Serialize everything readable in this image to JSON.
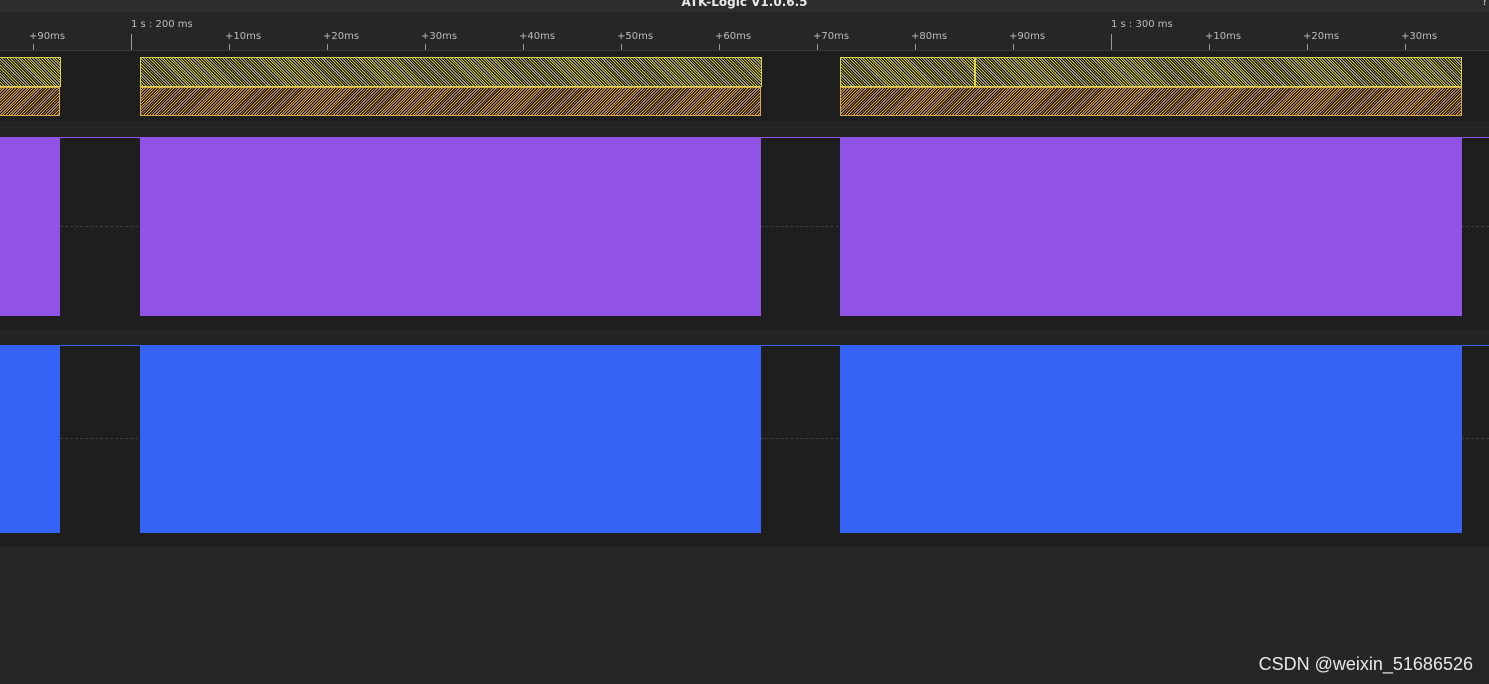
{
  "window": {
    "title": "ATK-Logic V1.0.6.5",
    "help_label": "?"
  },
  "ruler": {
    "markers": [
      "1 s : 200 ms",
      "1 s : 300 ms"
    ],
    "ticks": [
      "+90ms",
      "+10ms",
      "+20ms",
      "+30ms",
      "+40ms",
      "+50ms",
      "+60ms",
      "+70ms",
      "+80ms",
      "+90ms",
      "+10ms",
      "+20ms",
      "+30ms"
    ]
  },
  "channels": [
    {
      "id": "decoder",
      "colors": {
        "upper": "#d7d06a",
        "lower": "#e2a95a",
        "border": "#d9d34a"
      }
    },
    {
      "id": "ch-purple",
      "color": "#9152e6"
    },
    {
      "id": "ch-blue",
      "color": "#3463f5"
    }
  ],
  "icons": {
    "help": "help-icon"
  },
  "watermark": "CSDN @weixin_51686526"
}
